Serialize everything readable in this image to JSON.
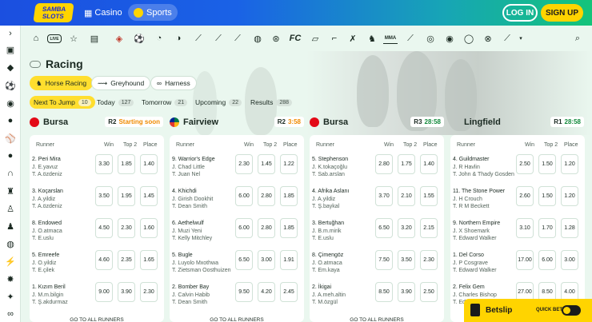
{
  "header": {
    "logo_text": "SAMBA SLOTS",
    "tabs": [
      {
        "label": "Casino"
      },
      {
        "label": "Sports"
      }
    ],
    "login_label": "LOG IN",
    "signup_label": "SIGN UP"
  },
  "sportbar": {
    "live_label": "LIVE",
    "icons": [
      "home-icon",
      "live-icon",
      "star-icon",
      "betslip-history-icon",
      "football-club-icon",
      "soccer-icon",
      "tennis-icon",
      "basketball-icon",
      "table-tennis-icon",
      "badminton-icon",
      "volleyball-icon",
      "esports-icon",
      "fc-icon",
      "baseball-icon",
      "cricket-icon",
      "hockey-icon",
      "mma-icon",
      "golf-icon",
      "darts-icon",
      "snooker-icon",
      "more-icon",
      "chevron-down-icon",
      "search-icon"
    ],
    "fc_label": "FC",
    "mma_label": "MMA"
  },
  "page": {
    "title": "Racing",
    "filters": [
      {
        "label": "Horse Racing",
        "active": true
      },
      {
        "label": "Greyhound",
        "active": false
      },
      {
        "label": "Harness",
        "active": false
      }
    ],
    "time_tabs": [
      {
        "label": "Next To Jump",
        "count": "10",
        "active": true
      },
      {
        "label": "Today",
        "count": "127",
        "active": false
      },
      {
        "label": "Tomorrow",
        "count": "21",
        "active": false
      },
      {
        "label": "Upcoming",
        "count": "22",
        "active": false
      },
      {
        "label": "Results",
        "count": "288",
        "active": false
      }
    ]
  },
  "columns_header": {
    "runner": "Runner",
    "win": "Win",
    "top2": "Top 2",
    "place": "Place"
  },
  "go_all_label": "GO TO ALL RUNNERS",
  "races": [
    {
      "venue": "Bursa",
      "race": "R2",
      "status": "Starting soon",
      "status_color": "#f08a00",
      "flag": "turkey",
      "runners": [
        {
          "name": "2. Peri Mira",
          "jockey": "J. E.yavuz",
          "trainer": "T. A.özdeniz",
          "win": "3.30",
          "top2": "1.85",
          "place": "1.40"
        },
        {
          "name": "3. Koçarslan",
          "jockey": "J. A.yildiz",
          "trainer": "T. A.özdeniz",
          "win": "3.50",
          "top2": "1.95",
          "place": "1.45"
        },
        {
          "name": "8. Endowed",
          "jockey": "J. O.atmaca",
          "trainer": "T. E.uslu",
          "win": "4.50",
          "top2": "2.30",
          "place": "1.60"
        },
        {
          "name": "5. Emreefe",
          "jockey": "J. O.yildiz",
          "trainer": "T. E.çilek",
          "win": "4.60",
          "top2": "2.35",
          "place": "1.65"
        },
        {
          "name": "1. Kızım Beril",
          "jockey": "J. M.m.bilgin",
          "trainer": "T. Ş.akdurmaz",
          "win": "9.00",
          "top2": "3.90",
          "place": "2.30"
        }
      ]
    },
    {
      "venue": "Fairview",
      "race": "R2",
      "status": "3:58",
      "status_color": "#f08a00",
      "flag": "south-africa",
      "runners": [
        {
          "name": "9. Warrior's Edge",
          "jockey": "J. Chad Little",
          "trainer": "T. Juan Nel",
          "win": "2.30",
          "top2": "1.45",
          "place": "1.22"
        },
        {
          "name": "4. Khichdi",
          "jockey": "J. Girish Dookhit",
          "trainer": "T. Dean Smith",
          "win": "6.00",
          "top2": "2.80",
          "place": "1.85"
        },
        {
          "name": "6. Aethelwulf",
          "jockey": "J. Muzi Yeni",
          "trainer": "T. Kelly Mitchley",
          "win": "6.00",
          "top2": "2.80",
          "place": "1.85"
        },
        {
          "name": "5. Bugle",
          "jockey": "J. Luyolo Mxothwa",
          "trainer": "T. Zietsman Oosthuizen",
          "win": "6.50",
          "top2": "3.00",
          "place": "1.91"
        },
        {
          "name": "2. Bomber Bay",
          "jockey": "J. Calvin Habib",
          "trainer": "T. Dean Smith",
          "win": "9.50",
          "top2": "4.20",
          "place": "2.45"
        }
      ]
    },
    {
      "venue": "Bursa",
      "race": "R3",
      "status": "28:58",
      "status_color": "#138a3c",
      "flag": "turkey",
      "runners": [
        {
          "name": "5. Stephenson",
          "jockey": "J. K.tokaçoğlu",
          "trainer": "T. Sab.arslan",
          "win": "2.80",
          "top2": "1.75",
          "place": "1.40"
        },
        {
          "name": "4. Afrika Aslanı",
          "jockey": "J. A.yildiz",
          "trainer": "T. Ş.baykal",
          "win": "3.70",
          "top2": "2.10",
          "place": "1.55"
        },
        {
          "name": "3. Bertuğhan",
          "jockey": "J. B.m.mirik",
          "trainer": "T. E.uslu",
          "win": "6.50",
          "top2": "3.20",
          "place": "2.15"
        },
        {
          "name": "8. Çimengöz",
          "jockey": "J. O.atmaca",
          "trainer": "T. Em.kaya",
          "win": "7.50",
          "top2": "3.50",
          "place": "2.30"
        },
        {
          "name": "2. İkigai",
          "jockey": "J. A.meh.altin",
          "trainer": "T. M.özgül",
          "win": "8.50",
          "top2": "3.90",
          "place": "2.50"
        }
      ]
    },
    {
      "venue": "Lingfield",
      "race": "R1",
      "status": "28:58",
      "status_color": "#138a3c",
      "flag": "",
      "runners": [
        {
          "name": "4. Guildmaster",
          "jockey": "J. R Havlin",
          "trainer": "T. John & Thady Gosden",
          "win": "2.50",
          "top2": "1.50",
          "place": "1.20"
        },
        {
          "name": "11. The Stone Power",
          "jockey": "J. H Crouch",
          "trainer": "T. R M Beckett",
          "win": "2.60",
          "top2": "1.50",
          "place": "1.20"
        },
        {
          "name": "9. Northern Empire",
          "jockey": "J. X Shoemark",
          "trainer": "T. Edward Walker",
          "win": "3.10",
          "top2": "1.70",
          "place": "1.28"
        },
        {
          "name": "1. Del Corso",
          "jockey": "J. P Cosgrave",
          "trainer": "T. Edward Walker",
          "win": "17.00",
          "top2": "6.00",
          "place": "3.00"
        },
        {
          "name": "2. Felix Gem",
          "jockey": "J. Charles Bishop",
          "trainer": "T. Edward Walker",
          "win": "27.00",
          "top2": "8.50",
          "place": "4.00"
        }
      ]
    }
  ],
  "betslip": {
    "label": "Betslip",
    "quickbet_label": "QUICK BET"
  },
  "colors": {
    "accent_yellow": "#ffde2e",
    "brand_blue": "#1b4fe0",
    "brand_green": "#14c47a"
  }
}
